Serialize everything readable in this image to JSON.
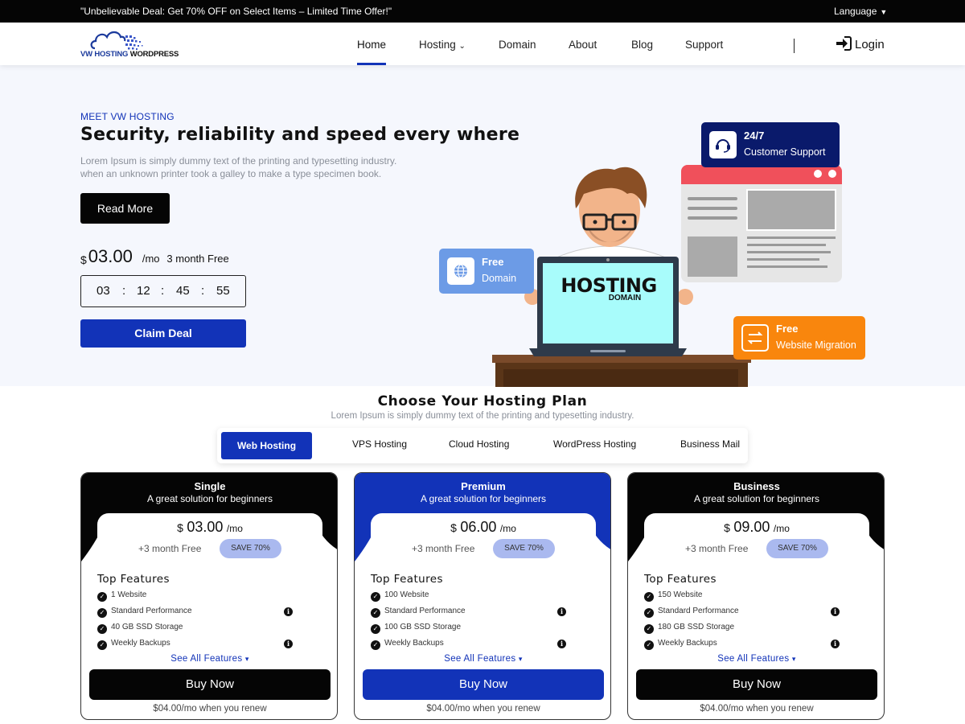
{
  "topbar": {
    "promo": "\"Unbelievable Deal: Get 70% OFF on Select Items – Limited Time Offer!\"",
    "language": "Language"
  },
  "logo": {
    "brand_left": "VW HOSTING",
    "brand_right": "WORDPRESS"
  },
  "nav": {
    "items": [
      {
        "label": "Home"
      },
      {
        "label": "Hosting"
      },
      {
        "label": "Domain"
      },
      {
        "label": "About"
      },
      {
        "label": "Blog"
      },
      {
        "label": "Support"
      }
    ],
    "login": "Login"
  },
  "hero": {
    "eyebrow": "MEET VW HOSTING",
    "title": "Security, reliability and speed every where",
    "desc_line1": "Lorem Ipsum is simply dummy text of the printing and typesetting industry.",
    "desc_line2": "when an unknown printer took a galley to make a type specimen book.",
    "read_more": "Read More",
    "price": {
      "currency": "$",
      "amount": "03.00",
      "per": "/mo",
      "free": "3 month Free"
    },
    "timer": {
      "h": "03",
      "m": "12",
      "s": "45",
      "f": "55",
      "sep": ":"
    },
    "claim": "Claim Deal",
    "badges": {
      "support_title": "24/7",
      "support_sub": "Customer Support",
      "domain_title": "Free",
      "domain_sub": "Domain",
      "migration_title": "Free",
      "migration_sub": "Website Migration"
    },
    "laptop_title": "HOSTING",
    "laptop_sub": "DOMAIN"
  },
  "plans": {
    "title": "Choose Your Hosting Plan",
    "subtitle": "Lorem Ipsum is simply dummy text of the printing and typesetting industry.",
    "tabs": [
      "Web Hosting",
      "VPS Hosting",
      "Cloud Hosting",
      "WordPress Hosting",
      "Business Mail"
    ],
    "cards": [
      {
        "name": "Single",
        "tagline": "A great solution for beginners",
        "currency": "$",
        "price": "03.00",
        "per": "/mo",
        "extra": "+3 month Free",
        "save": "SAVE 70%",
        "features_title": "Top Features",
        "features": [
          "1 Website",
          "Standard Performance",
          "40 GB SSD Storage",
          "Weekly Backups"
        ],
        "see_all": "See All Features",
        "buy": "Buy Now",
        "renew": "$04.00/mo when you renew"
      },
      {
        "name": "Premium",
        "tagline": "A great solution for beginners",
        "currency": "$",
        "price": "06.00",
        "per": "/mo",
        "extra": "+3 month Free",
        "save": "SAVE 70%",
        "features_title": "Top Features",
        "features": [
          "100 Website",
          "Standard Performance",
          "100 GB SSD Storage",
          "Weekly Backups"
        ],
        "see_all": "See All Features",
        "buy": "Buy Now",
        "renew": "$04.00/mo when you renew"
      },
      {
        "name": "Business",
        "tagline": "A great solution for beginners",
        "currency": "$",
        "price": "09.00",
        "per": "/mo",
        "extra": "+3 month Free",
        "save": "SAVE 70%",
        "features_title": "Top Features",
        "features": [
          "150 Website",
          "Standard Performance",
          "180 GB SSD Storage",
          "Weekly Backups"
        ],
        "see_all": "See All Features",
        "buy": "Buy Now",
        "renew": "$04.00/mo when you renew"
      }
    ]
  },
  "colors": {
    "accent": "#1233b8",
    "dark": "#050505",
    "hero_bg": "#f5f7fd",
    "save_pill": "#aab9ef",
    "migration": "#f9860d",
    "domain_badge": "#6c9be6",
    "browser_top": "#f0505b"
  }
}
